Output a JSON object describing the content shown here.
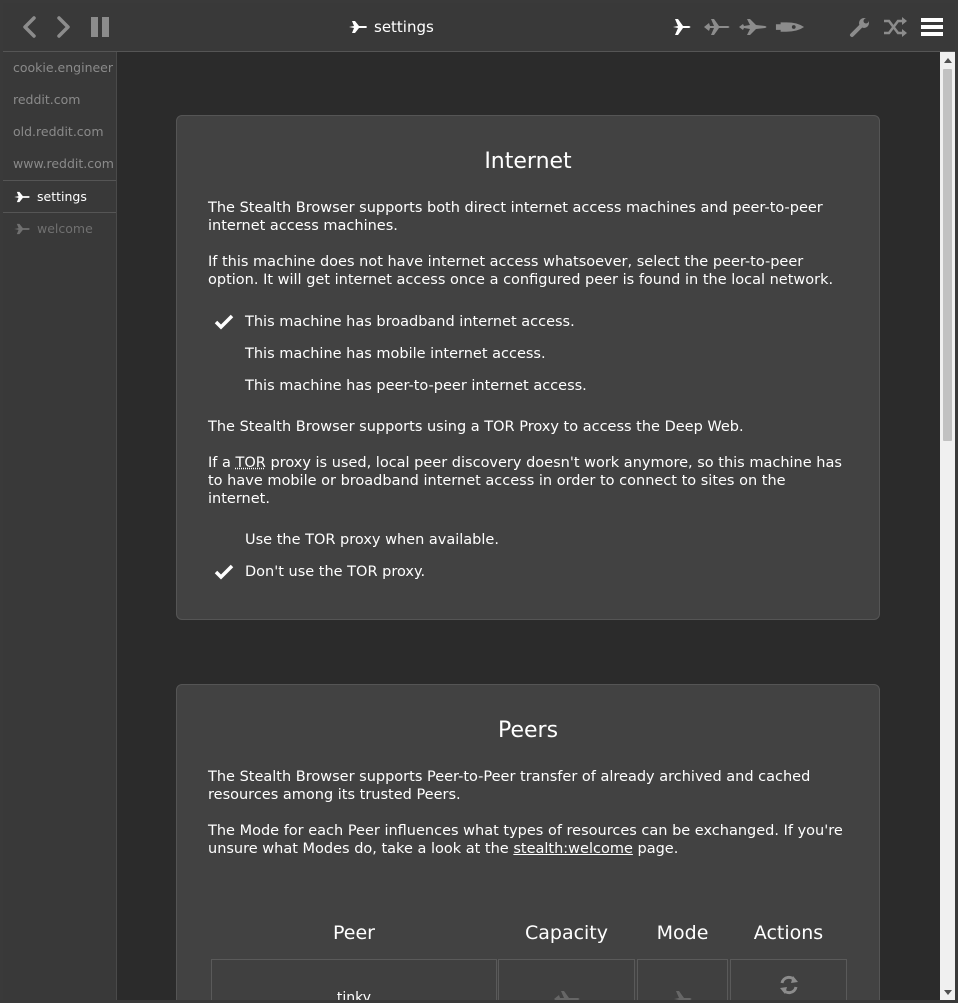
{
  "header": {
    "title": "settings"
  },
  "sidebar": {
    "tabs": [
      {
        "label": "cookie.engineer",
        "state": "inactive"
      },
      {
        "label": "reddit.com",
        "state": "inactive"
      },
      {
        "label": "old.reddit.com",
        "state": "inactive"
      },
      {
        "label": "www.reddit.com",
        "state": "inactive"
      },
      {
        "label": "settings",
        "state": "active"
      },
      {
        "label": "welcome",
        "state": "inactive"
      }
    ]
  },
  "internet": {
    "title": "Internet",
    "p1": "The Stealth Browser supports both direct internet access machines and peer-to-peer internet access machines.",
    "p2": "If this machine does not have internet access whatsoever, select the peer-to-peer option. It will get internet access once a configured peer is found in the local network.",
    "options": [
      {
        "label": "This machine has broadband internet access.",
        "checked": true
      },
      {
        "label": "This machine has mobile internet access.",
        "checked": false
      },
      {
        "label": "This machine has peer-to-peer internet access.",
        "checked": false
      }
    ],
    "p3": "The Stealth Browser supports using a TOR Proxy to access the Deep Web.",
    "p4_pre": "If a ",
    "p4_abbr": "TOR",
    "p4_post": " proxy is used, local peer discovery doesn't work anymore, so this machine has to have mobile or broadband internet access in order to connect to sites on the internet.",
    "tor_options": [
      {
        "label": "Use the TOR proxy when available.",
        "checked": false
      },
      {
        "label": "Don't use the TOR proxy.",
        "checked": true
      }
    ]
  },
  "peers": {
    "title": "Peers",
    "p1": "The Stealth Browser supports Peer-to-Peer transfer of already archived and cached resources among its trusted Peers.",
    "p2_pre": "The Mode for each Peer influences what types of resources can be exchanged. If you're unsure what Modes do, take a look at the ",
    "p2_link": "stealth:welcome",
    "p2_post": " page.",
    "columns": [
      "Peer",
      "Capacity",
      "Mode",
      "Actions"
    ],
    "row_peer": "tinky"
  },
  "colors": {
    "background": "#2b2b2b",
    "panel": "#424242",
    "chrome": "#393939",
    "text": "#ffffff",
    "muted": "#8a8a8a"
  }
}
